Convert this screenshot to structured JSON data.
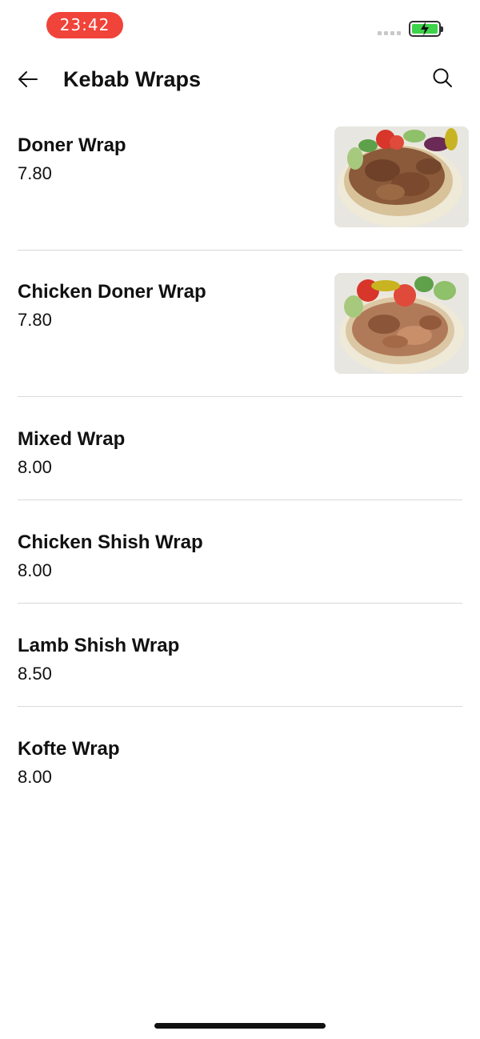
{
  "status_bar": {
    "time": "23:42",
    "battery_color": "#3dd34a",
    "time_pill_color": "#f0433a"
  },
  "header": {
    "title": "Kebab Wraps",
    "back_icon": "arrow-left-icon",
    "search_icon": "search-icon"
  },
  "menu": {
    "items": [
      {
        "name": "Doner Wrap",
        "price": "7.80",
        "has_image": true,
        "image_icon": "doner-wrap-photo"
      },
      {
        "name": "Chicken Doner Wrap",
        "price": "7.80",
        "has_image": true,
        "image_icon": "chicken-doner-wrap-photo"
      },
      {
        "name": "Mixed Wrap",
        "price": "8.00",
        "has_image": false
      },
      {
        "name": "Chicken Shish Wrap",
        "price": "8.00",
        "has_image": false
      },
      {
        "name": "Lamb Shish Wrap",
        "price": "8.50",
        "has_image": false
      },
      {
        "name": "Kofte Wrap",
        "price": "8.00",
        "has_image": false
      }
    ]
  }
}
